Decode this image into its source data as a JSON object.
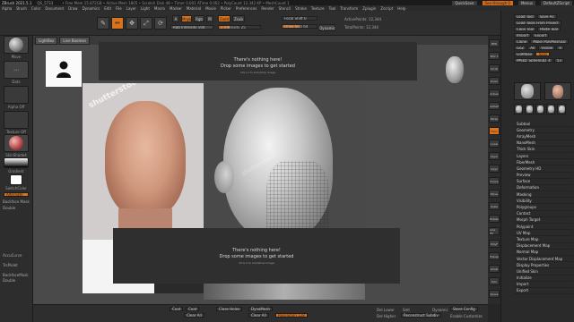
{
  "titlebar": {
    "app": "ZBrush 2021.5.1",
    "file": "QS_5733",
    "stats": "• Free Mem 15.872GB • Active Mem 1805 • Scratch Disk 48 • Timer 0.001 ATime 0.002 • PolyCount 12.342 KP • MeshCount 1",
    "quicksave": "QuickSave",
    "see_through": "See-through 0",
    "menus": "Menus",
    "default_script": "DefaultZScript"
  },
  "menubar": [
    "Alpha",
    "Brush",
    "Color",
    "Document",
    "Draw",
    "Dynamics",
    "Edit",
    "File",
    "Layer",
    "Light",
    "Macro",
    "Marker",
    "Material",
    "Movie",
    "Picker",
    "Preferences",
    "Render",
    "Stencil",
    "Stroke",
    "Texture",
    "Tool",
    "Transform",
    "Zplugin",
    "Zscript",
    "Help"
  ],
  "shelf": {
    "lightbox": "LightBox",
    "live_boolean": "Live Boolean",
    "edit": "Edit",
    "draw": "Draw",
    "move": "Move",
    "scale": "Scale",
    "rotate": "Rotate",
    "a": "A",
    "mrgb": "Mrgb",
    "rgb": "Rgb",
    "m": "M",
    "rgb_intensity": "Rgb Intensity 100",
    "zadd": "Zadd",
    "zsub": "Zsub",
    "z_intensity": "Z Intensity 25",
    "focal_shift": "Focal Shift 0",
    "draw_size": "Draw Size 64",
    "dynamic": "Dynamic",
    "active_points": "ActivePoints: 12,344",
    "total_points": "TotalPoints: 12,344",
    "z_intensity_fill": 0.25,
    "rgb_intensity_fill": 1.0,
    "draw_size_fill": 0.5
  },
  "leftpanel": {
    "brush_label": "Move",
    "stroke_label": "Dots",
    "alpha_label": "Alpha Off",
    "texture_label": "Texture Off",
    "material_label": "SkinShade4",
    "gradient_label": "Gradient",
    "switch_color": "SwitchColor",
    "alternate": "Alternate",
    "backface": "Backface Mask",
    "double": "Double",
    "backface_mask": "BackfaceMask",
    "accucurve": "AccuCurve",
    "transpose": "TrsPlelet",
    "color_fill": "Fill"
  },
  "canvas": {
    "tabs": [
      "LightBox",
      "Live Boolean"
    ],
    "drop_top": {
      "line1": "There's nothing here!",
      "line2": "Drop some images to get started",
      "line3": "Ctrl+V to add/show image"
    },
    "drop_bottom": {
      "line1": "There's nothing here!",
      "line2": "Drop some images to get started",
      "line3": "Ctrl+V to add/show image"
    },
    "photo_watermark": "shutterstock",
    "sculpt_watermark": "shutterstock"
  },
  "rcol": [
    "BPR",
    "SPix 3",
    "Scroll",
    "Zoom",
    "Actual",
    "AAHalf",
    "Persp",
    "Floor",
    "Local",
    "LSym",
    "Gxyz",
    "Frame",
    "Move",
    "Scale",
    "Rotate",
    "Line Fill",
    "PolyF",
    "Transp",
    "Ghost",
    "Solo",
    "Xpose"
  ],
  "rpanel": {
    "rows": [
      [
        "Load Tool",
        "Save As"
      ],
      [
        "Load Tools From Project"
      ],
      [
        "Copy Tool",
        "Paste Tool"
      ],
      [
        "Import",
        "Export"
      ],
      [
        "Clone",
        "Make PolyMesh3D"
      ],
      [
        "GoZ",
        "All",
        "Visible",
        "R"
      ],
      [
        "Lightbox",
        "Tools"
      ],
      [
        "PM3D_Sphere3D_4",
        "53"
      ]
    ],
    "list": [
      "Subtool",
      "Geometry",
      "ArrayMesh",
      "NanoMesh",
      "Thick Skin",
      "Layers",
      "FiberMesh",
      "Geometry HD",
      "Preview",
      "Surface",
      "Deformation",
      "Masking",
      "Visibility",
      "Polygroups",
      "Contact",
      "Morph Target",
      "Polypaint",
      "UV Map",
      "Texture Map",
      "Displacement Map",
      "Normal Map",
      "Vector Displacement Map",
      "Display Properties",
      "Unified Skin",
      "Initialize",
      "Import",
      "Export"
    ]
  },
  "bottombar": {
    "coat": "Coat",
    "coat2": "Coat",
    "close_holes": "Close Holes",
    "dynamesh": "DynaMesh",
    "clear_all": "Clear All",
    "clear_all2": "Clear All",
    "resolution": "Resolution 128",
    "del_lower": "Del Lower",
    "dynamic_sub": "Dynamic",
    "reconstruct": "Reconstruct Subdiv",
    "store_config": "Store Config",
    "enable_customize": "Enable Customize",
    "del_higher": "Del Higher",
    "smt": "Smt",
    "sdiv": "SDiv"
  }
}
